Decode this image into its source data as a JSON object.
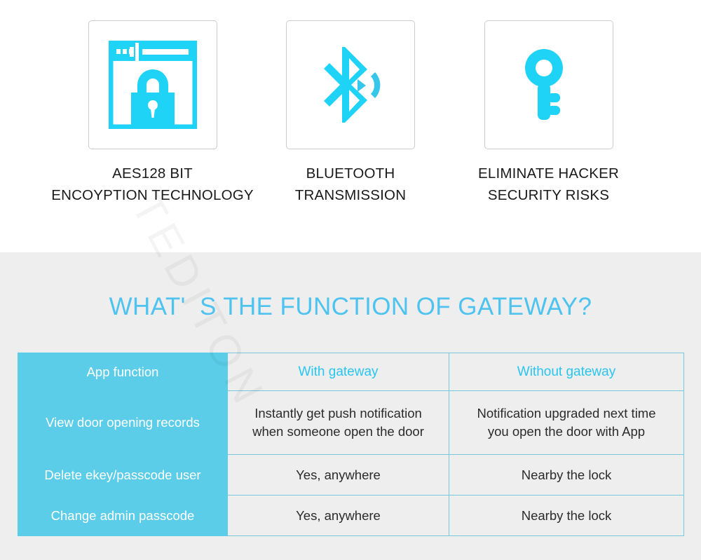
{
  "features": [
    {
      "icon": "browser-lock-icon",
      "caption": "AES128 BIT\nENCOYPTION TECHNOLOGY"
    },
    {
      "icon": "bluetooth-signal-icon",
      "caption": "BLUETOOTH\nTRANSMISSION"
    },
    {
      "icon": "key-icon",
      "caption": "ELIMINATE HACKER\nSECURITY RISKS"
    }
  ],
  "section": {
    "title": "WHAT'  S THE FUNCTION OF GATEWAY?"
  },
  "table": {
    "headers": [
      "App function",
      "With gateway",
      "Without gateway"
    ],
    "rows": [
      {
        "label": "View door opening records",
        "with_gateway": "Instantly get push notification\nwhen someone open the door",
        "without_gateway": "Notification upgraded next time\nyou open the door with App"
      },
      {
        "label": "Delete ekey/passcode user",
        "with_gateway": "Yes, anywhere",
        "without_gateway": "Nearby the lock"
      },
      {
        "label": "Change admin passcode",
        "with_gateway": "Yes, anywhere",
        "without_gateway": "Nearby the lock"
      }
    ]
  },
  "watermark": {
    "text": "TEDITON"
  },
  "colors": {
    "icon_cyan": "#1fd3f7",
    "title_blue": "#4ec3ef",
    "table_label_bg": "#5bcde8",
    "table_head_text": "#29c5f0",
    "table_border": "#79c6dd",
    "band_gray": "#eeeeee"
  }
}
